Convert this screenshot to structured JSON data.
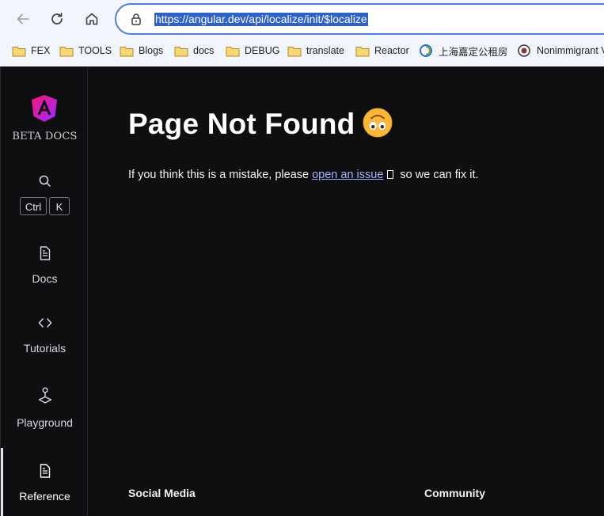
{
  "browser": {
    "url": "https://angular.dev/api/localize/init/$localize",
    "bookmarks": [
      {
        "label": "FEX",
        "type": "folder"
      },
      {
        "label": "TOOLS",
        "type": "folder"
      },
      {
        "label": "Blogs",
        "type": "folder"
      },
      {
        "label": "docs",
        "type": "folder"
      },
      {
        "label": "DEBUG",
        "type": "folder"
      },
      {
        "label": "translate",
        "type": "folder"
      },
      {
        "label": "Reactor",
        "type": "folder"
      },
      {
        "label": "上海嘉定公租房",
        "type": "site"
      },
      {
        "label": "Nonimmigrant V",
        "type": "site"
      }
    ]
  },
  "sidebar": {
    "brand_label": "BETA DOCS",
    "search": {
      "key1": "Ctrl",
      "key2": "K"
    },
    "items": [
      {
        "label": "Docs",
        "icon": "document-icon"
      },
      {
        "label": "Tutorials",
        "icon": "code-icon"
      },
      {
        "label": "Playground",
        "icon": "joystick-icon"
      },
      {
        "label": "Reference",
        "icon": "document-icon",
        "active": true
      }
    ]
  },
  "main": {
    "title": "Page Not Found",
    "message_before": "If you think this is a mistake, please ",
    "link_text": "open an issue",
    "message_after": " so we can fix it.",
    "footer": {
      "social": "Social Media",
      "community": "Community"
    }
  },
  "colors": {
    "page_bg": "#0f0f11",
    "link": "#a2b3ff",
    "url_highlight": "#2f62c6",
    "omnibox_border": "#4f7fd6"
  }
}
